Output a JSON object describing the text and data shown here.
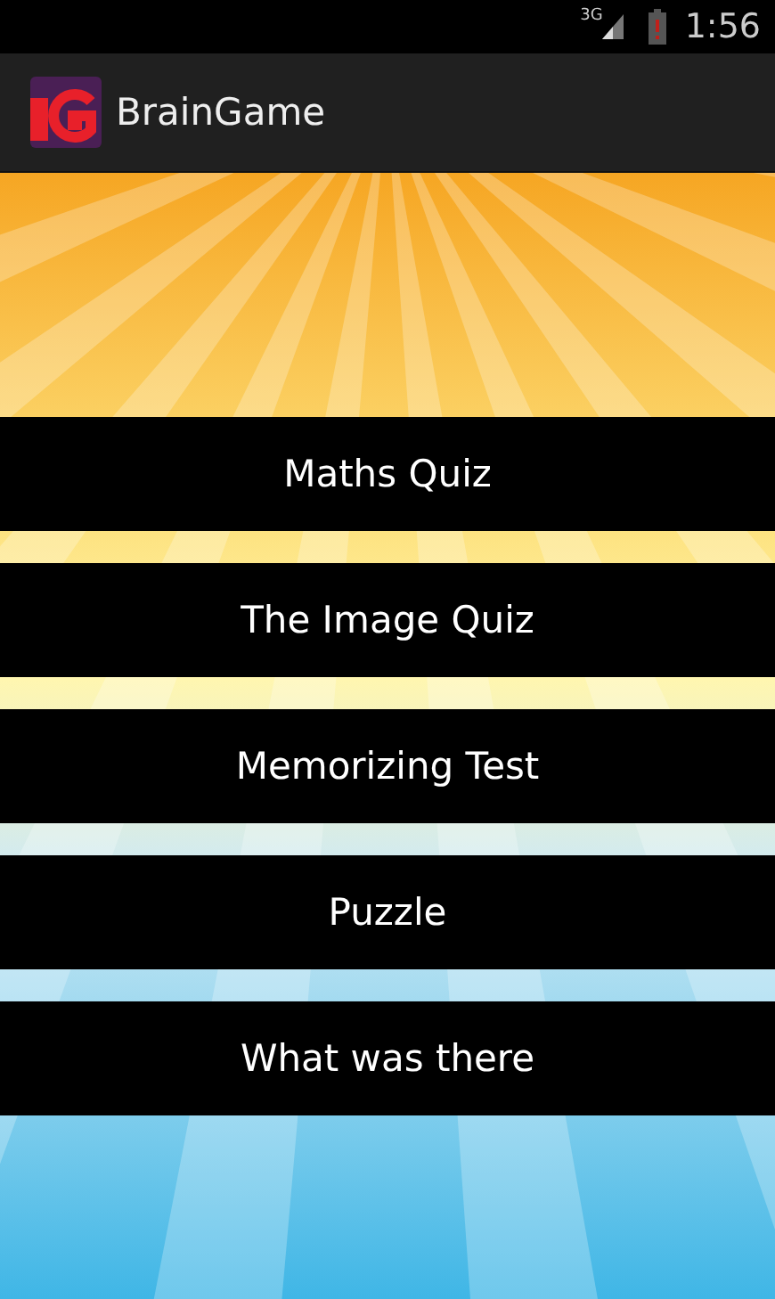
{
  "status_bar": {
    "network": "3G",
    "time": "1:56"
  },
  "app_bar": {
    "title": "BrainGame"
  },
  "menu": [
    {
      "label": "Maths Quiz"
    },
    {
      "label": "The Image Quiz"
    },
    {
      "label": "Memorizing Test"
    },
    {
      "label": "Puzzle"
    },
    {
      "label": "What was there"
    }
  ]
}
